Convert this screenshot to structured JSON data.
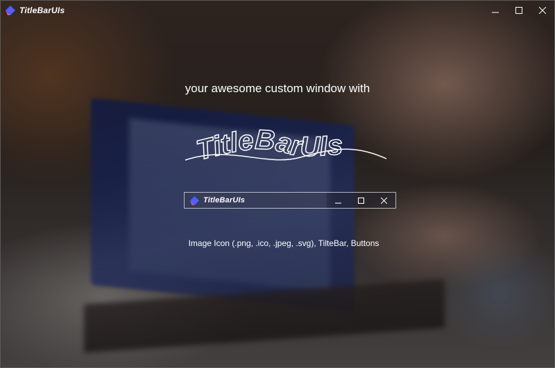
{
  "window": {
    "title": "TitleBarUIs",
    "icon": "titlebaruis-logo-icon",
    "buttons": [
      "minimize-icon",
      "maximize-icon",
      "close-icon"
    ]
  },
  "main": {
    "tagline": "your awesome custom window with",
    "logo_text": "TitleBarUIs",
    "preview": {
      "title": "TitleBarUIs",
      "buttons": [
        "minimize-icon",
        "maximize-icon",
        "close-icon"
      ]
    },
    "caption": "Image Icon (.png, .ico, .jpeg, .svg), TilteBar, Buttons"
  },
  "colors": {
    "text": "#ffffff",
    "icon_blue": "#2f6bff",
    "icon_pink": "#e0509c",
    "icon_purple": "#7a4cff"
  }
}
